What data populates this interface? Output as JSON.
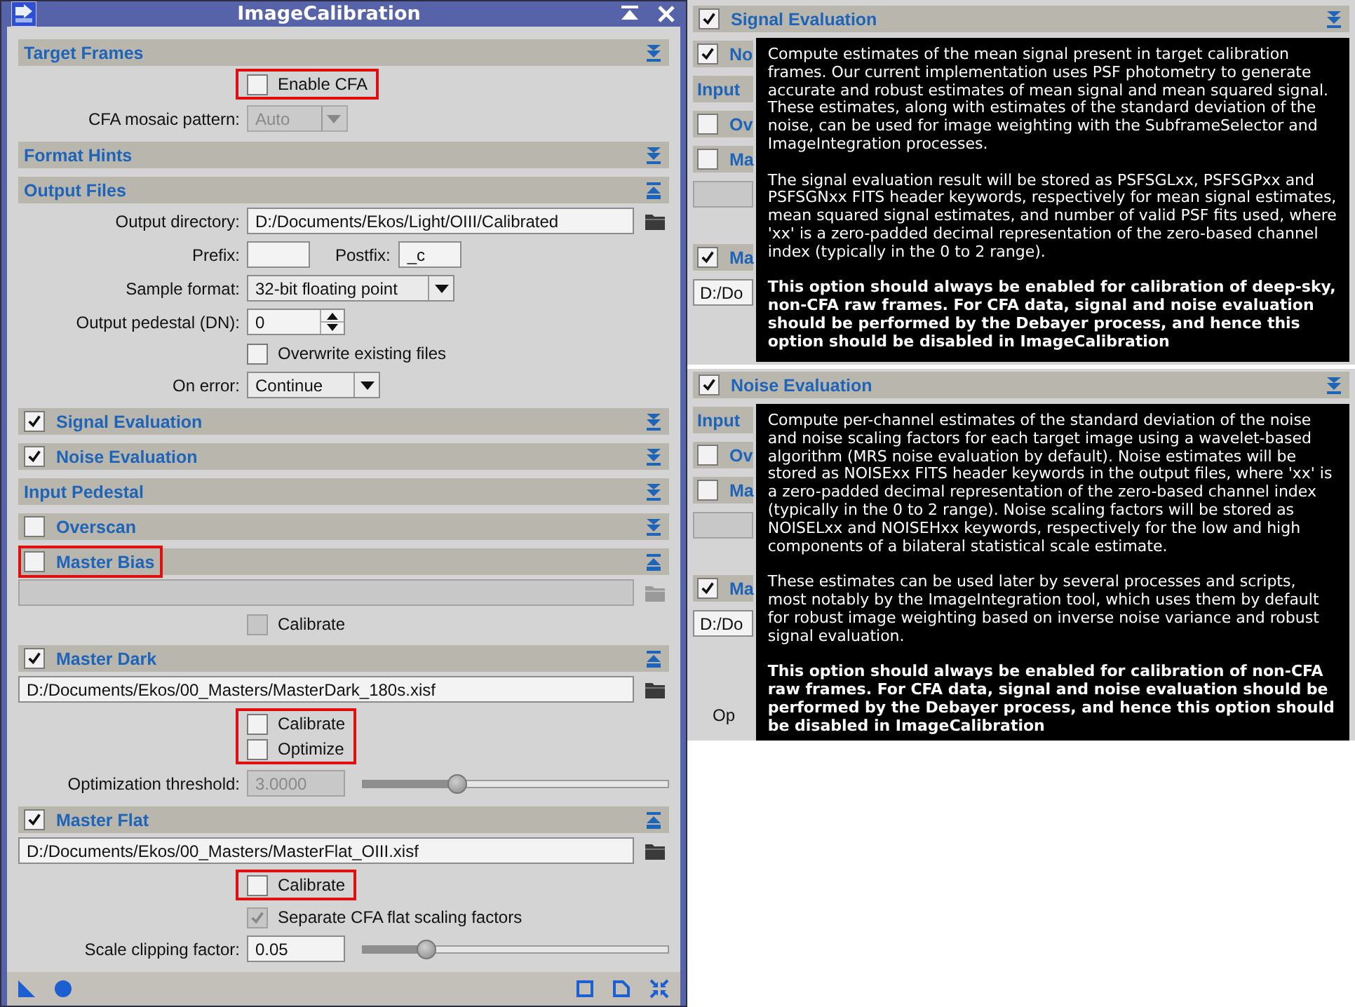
{
  "window": {
    "title": "ImageCalibration"
  },
  "sections": [
    {
      "title": "Target Frames",
      "expanded": false,
      "rows": [
        {
          "kind": "checks",
          "highlighted": true,
          "items": [
            {
              "label": "Enable CFA",
              "checked": false,
              "disabled": false
            }
          ]
        },
        {
          "kind": "combo",
          "label": "CFA mosaic pattern:",
          "value": "Auto",
          "disabled": true
        }
      ]
    },
    {
      "title": "Format Hints",
      "expanded": false
    },
    {
      "title": "Output Files",
      "expanded": true,
      "rows": [
        {
          "kind": "path",
          "label": "Output directory:",
          "value": "D:/Documents/Ekos/Light/OIII/Calibrated",
          "disabled": false
        },
        {
          "kind": "pair",
          "fields": [
            {
              "label": "Prefix:"
            },
            {
              "label": "Postfix:",
              "value": "_c"
            }
          ]
        },
        {
          "kind": "combo",
          "label": "Sample format:",
          "value": "32-bit floating point",
          "disabled": false
        },
        {
          "kind": "spin",
          "label": "Output pedestal (DN):",
          "value": "0"
        },
        {
          "kind": "checks",
          "highlighted": false,
          "items": [
            {
              "label": "Overwrite existing files",
              "checked": false,
              "disabled": false
            }
          ]
        },
        {
          "kind": "combo",
          "label": "On error:",
          "value": "Continue",
          "disabled": false
        }
      ]
    },
    {
      "title": "Signal Evaluation",
      "checked": true,
      "expanded": false
    },
    {
      "title": "Noise Evaluation",
      "checked": true,
      "expanded": false
    },
    {
      "title": "Input Pedestal",
      "expanded": false
    },
    {
      "title": "Overscan",
      "checked": false,
      "expanded": false
    },
    {
      "title": "Master Bias",
      "checked": false,
      "highlighted": true,
      "expanded": true,
      "rows": [
        {
          "kind": "path",
          "disabled": true
        },
        {
          "kind": "checks",
          "highlighted": false,
          "items": [
            {
              "label": "Calibrate",
              "checked": false,
              "disabled": true
            }
          ]
        }
      ]
    },
    {
      "title": "Master Dark",
      "checked": true,
      "expanded": true,
      "rows": [
        {
          "kind": "path",
          "value": "D:/Documents/Ekos/00_Masters/MasterDark_180s.xisf",
          "disabled": false
        },
        {
          "kind": "checks",
          "highlighted": true,
          "items": [
            {
              "label": "Calibrate",
              "checked": false,
              "disabled": false
            },
            {
              "label": "Optimize",
              "checked": false,
              "disabled": false
            }
          ]
        },
        {
          "kind": "slider",
          "label": "Optimization threshold:",
          "value": "3.0000",
          "disabled": true,
          "level": 0.31
        }
      ]
    },
    {
      "title": "Master Flat",
      "checked": true,
      "expanded": true,
      "rows": [
        {
          "kind": "path",
          "value": "D:/Documents/Ekos/00_Masters/MasterFlat_OIII.xisf",
          "disabled": false
        },
        {
          "kind": "checks",
          "highlighted": true,
          "items": [
            {
              "label": "Calibrate",
              "checked": false,
              "disabled": false
            }
          ]
        },
        {
          "kind": "checks",
          "highlighted": false,
          "items": [
            {
              "label": "Separate CFA flat scaling factors",
              "checked": true,
              "disabled": true
            }
          ]
        },
        {
          "kind": "slider",
          "label": "Scale clipping factor:",
          "value": "0.05",
          "disabled": false,
          "level": 0.21
        }
      ]
    }
  ],
  "snapshots": [
    {
      "header": {
        "title": "Signal Evaluation",
        "checked": true,
        "expanded": false
      },
      "slivers": [
        {
          "kind": "check",
          "text": "No",
          "checked": true
        },
        {
          "kind": "plain",
          "text": "Input"
        },
        {
          "kind": "check",
          "text": "Ov",
          "checked": false
        },
        {
          "kind": "check",
          "text": "Ma",
          "checked": false
        },
        {
          "kind": "field",
          "disabled": true
        },
        {
          "kind": "gap"
        },
        {
          "kind": "check",
          "text": "Ma",
          "checked": true
        },
        {
          "kind": "field",
          "text": "D:/Do",
          "disabled": false
        }
      ],
      "tooltip": [
        {
          "text": "Compute estimates of the mean signal present in target calibration frames. Our current implementation uses PSF photometry to generate accurate and robust estimates of mean signal and mean squared signal. These estimates, along with estimates of the standard deviation of the noise, can be used for image weighting with the SubframeSelector and ImageIntegration processes.",
          "bold": false
        },
        {
          "text": "The signal evaluation result will be stored as PSFSGLxx, PSFSGPxx and PSFSGNxx FITS header keywords, respectively for mean signal estimates, mean squared signal estimates, and number of valid PSF fits used, where 'xx' is a zero-padded decimal representation of the zero-based channel index (typically in the 0 to 2 range).",
          "bold": false
        },
        {
          "text": "This option should always be enabled for calibration of deep-sky, non-CFA raw frames. For CFA data, signal and noise evaluation should be performed by the Debayer process, and hence this option should be disabled in ImageCalibration",
          "bold": true
        }
      ]
    },
    {
      "header": {
        "title": "Noise Evaluation",
        "checked": true,
        "expanded": false
      },
      "slivers": [
        {
          "kind": "plain",
          "text": "Input"
        },
        {
          "kind": "check",
          "text": "Ov",
          "checked": false
        },
        {
          "kind": "check",
          "text": "Ma",
          "checked": false
        },
        {
          "kind": "field",
          "disabled": true
        },
        {
          "kind": "gap"
        },
        {
          "kind": "check",
          "text": "Ma",
          "checked": true
        },
        {
          "kind": "field",
          "text": "D:/Do",
          "disabled": false
        },
        {
          "kind": "gap"
        },
        {
          "kind": "gap"
        },
        {
          "kind": "label",
          "text": "Op"
        }
      ],
      "tooltip": [
        {
          "text": "Compute per-channel estimates of the standard deviation of the noise and noise scaling factors for each target image using a wavelet-based algorithm (MRS noise evaluation by default). Noise estimates will be stored as NOISExx FITS header keywords in the output files, where 'xx' is a zero-padded decimal representation of the zero-based channel index (typically in the 0 to 2 range). Noise scaling factors will be stored as NOISELxx and NOISEHxx keywords, respectively for the low and high components of a bilateral statistical scale estimate.",
          "bold": false
        },
        {
          "text": "These estimates can be used later by several processes and scripts, most notably by the ImageIntegration tool, which uses them by default for robust image weighting based on inverse noise variance and robust signal evaluation.",
          "bold": false
        },
        {
          "text": "This option should always be enabled for calibration of non-CFA raw frames. For CFA data, signal and noise evaluation should be performed by the Debayer process, and hence this option should be disabled in ImageCalibration",
          "bold": true
        }
      ]
    }
  ]
}
